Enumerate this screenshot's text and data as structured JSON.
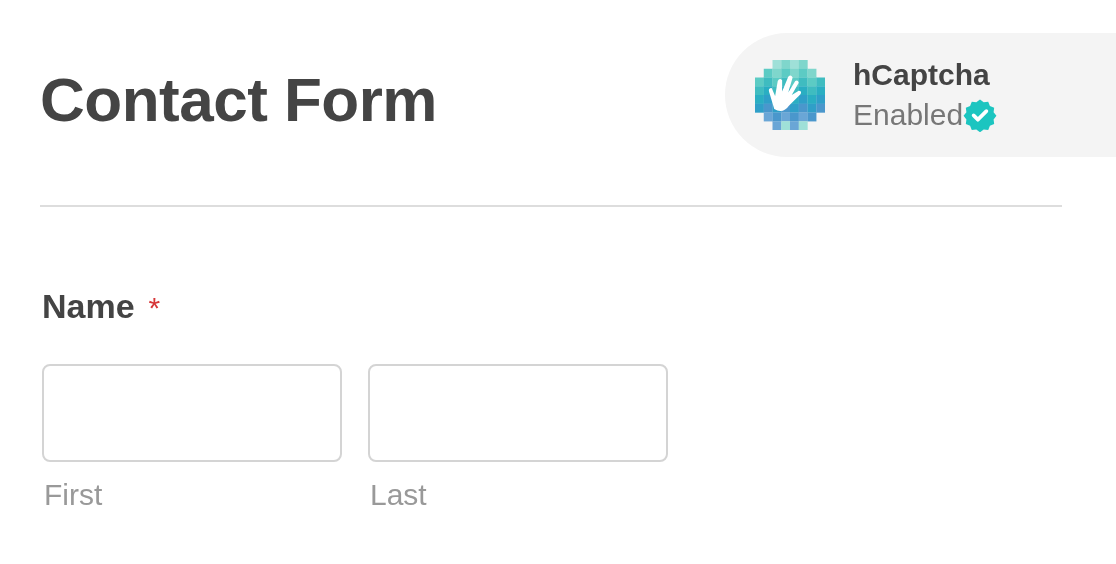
{
  "title": "Contact Form",
  "badge": {
    "name": "hCaptcha",
    "status": "Enabled",
    "verified": true
  },
  "fields": [
    {
      "label": "Name",
      "required": true,
      "required_mark": "*",
      "inputs": [
        {
          "sublabel": "First"
        },
        {
          "sublabel": "Last"
        }
      ]
    }
  ]
}
